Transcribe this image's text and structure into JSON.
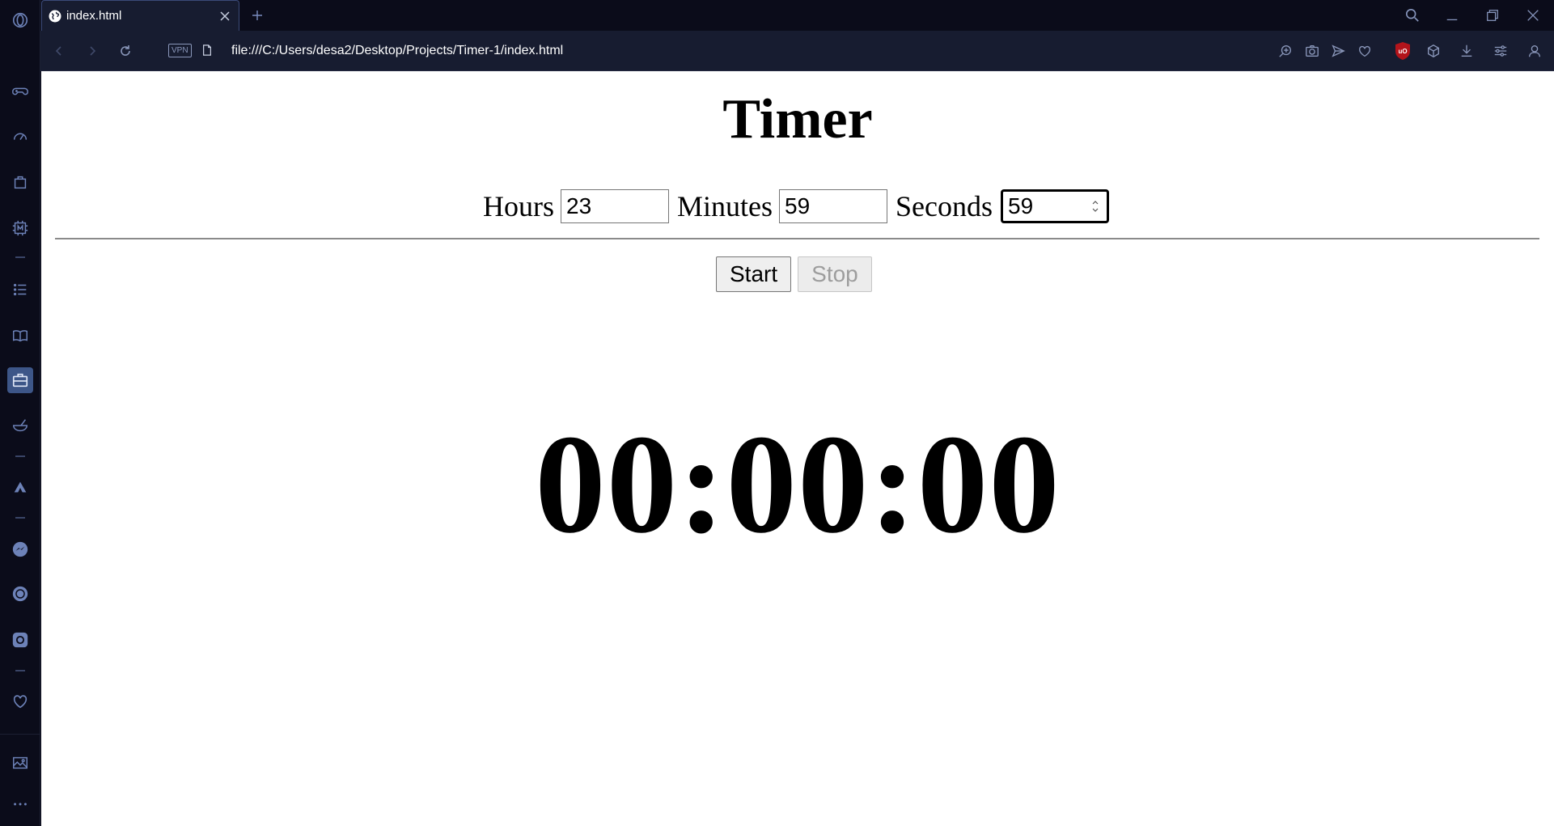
{
  "browser": {
    "tab": {
      "title": "index.html"
    },
    "address_bar": {
      "vpn_label": "VPN",
      "url": "file:///C:/Users/desa2/Desktop/Projects/Timer-1/index.html"
    },
    "ublock_label": "uO"
  },
  "page": {
    "title": "Timer",
    "fields": {
      "hours": {
        "label": "Hours",
        "value": "23"
      },
      "minutes": {
        "label": "Minutes",
        "value": "59"
      },
      "seconds": {
        "label": "Seconds",
        "value": "59"
      }
    },
    "buttons": {
      "start": "Start",
      "stop": "Stop"
    },
    "clock": "00:00:00"
  },
  "colors": {
    "chrome_bg": "#0b0c1a",
    "toolbar_bg": "#171c30",
    "icon": "#8a97ba",
    "sidebar_active": "#3d5688",
    "ublock_red": "#b3141b"
  }
}
